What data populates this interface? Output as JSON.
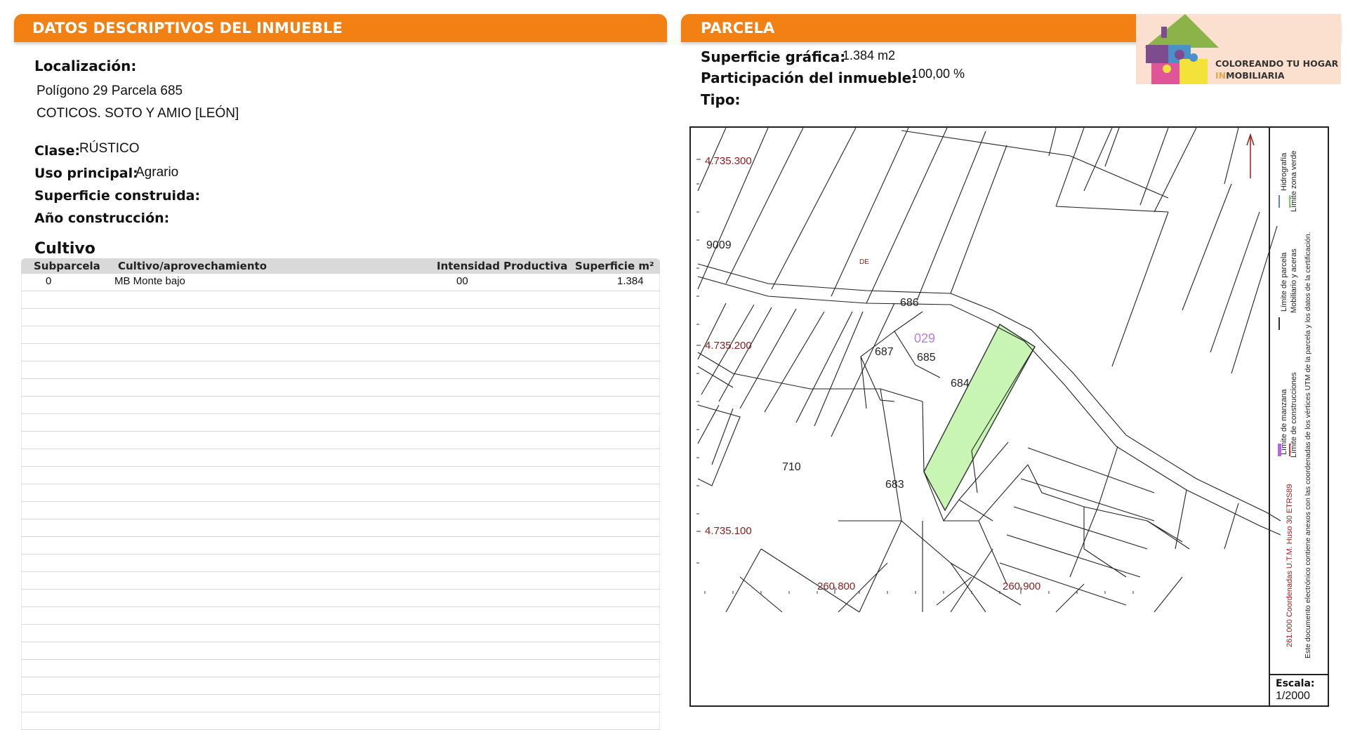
{
  "left_panel": {
    "header_prefix": "DATOS DESCRIPTIVOS DEL ",
    "header_bold": "INMUEBLE",
    "localizacion_label": "Localización:",
    "localizacion_line1": "Polígono 29 Parcela 685",
    "localizacion_line2": "COTICOS. SOTO Y AMIO [LEÓN]",
    "clase_label": "Clase:",
    "clase_value": "RÚSTICO",
    "uso_label": "Uso principal:",
    "uso_value": "Agrario",
    "superficie_construida_label": "Superficie construida:",
    "anio_label": "Año construcción:",
    "cultivo_title": "Cultivo",
    "table": {
      "headers": [
        "Subparcela",
        "Cultivo/aprovechamiento",
        "Intensidad Productiva",
        "Superficie m²"
      ],
      "rows": [
        [
          "0",
          "MB Monte bajo",
          "00",
          "1.384"
        ]
      ]
    }
  },
  "right_panel": {
    "header": "PARCELA",
    "superficie_label": "Superficie gráfica:",
    "superficie_value": "1.384 m2",
    "participacion_label": "Participación del inmueble:",
    "participacion_value": "100,00 %",
    "tipo_label": "Tipo:"
  },
  "logo": {
    "line1": "COLOREANDO TU HOGAR",
    "line2_accent": "IN",
    "line2_rest": "MOBILIARIA"
  },
  "map": {
    "y_coords": [
      "4.735.300",
      "4.735.200",
      "4.735.100"
    ],
    "x_coords": [
      "260.800",
      "260.900"
    ],
    "road_label": "9009",
    "road_tag": "DE",
    "polygon_label": "029",
    "parcels": [
      "686",
      "687",
      "685",
      "684",
      "710",
      "683"
    ],
    "highlight_color": "#c8f5b4",
    "scale_label": "Escala:",
    "scale_value": "1/2000",
    "legend": {
      "manzana": "Límite de manzana",
      "construcciones": "Límite de construcciones",
      "parcela": "Límite de parcela",
      "mobiliario": "Mobiliario y aceras",
      "hidrografia": "Hidrografía",
      "zona_verde": "Límite zona verde",
      "coords": "261.000 Coordenadas U.T.M. Huso 30 ETRS89",
      "note": "Este documento electrónico contiene anexos con las coordenadas de los vértices UTM de la parcela y los datos de la certificación."
    }
  }
}
